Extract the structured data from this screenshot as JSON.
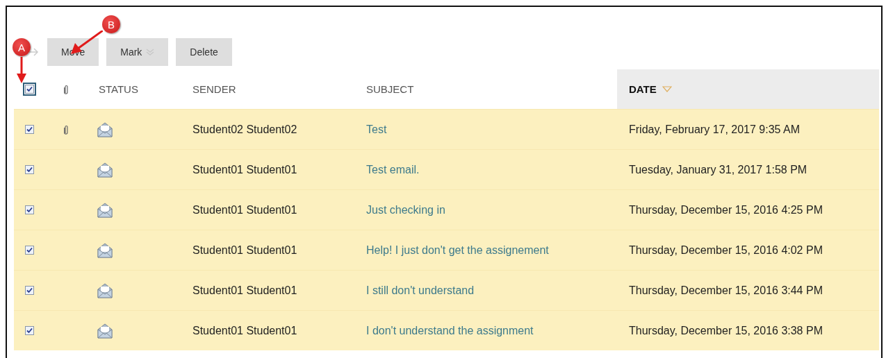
{
  "callouts": [
    {
      "label": "A",
      "kind": "down"
    },
    {
      "label": "B",
      "kind": "diagonal"
    }
  ],
  "toolbar": {
    "buttons": [
      {
        "label": "Move",
        "kind": "plain"
      },
      {
        "label": "Mark",
        "kind": "menu"
      },
      {
        "label": "Delete",
        "kind": "plain"
      }
    ]
  },
  "table": {
    "select_all": {
      "checked": true
    },
    "columns": [
      {
        "label": "STATUS",
        "sorted": false
      },
      {
        "label": "SENDER",
        "sorted": false
      },
      {
        "label": "SUBJECT",
        "sorted": false
      },
      {
        "label": "DATE",
        "sorted": true
      }
    ],
    "rows": [
      {
        "checked": true,
        "attachment": true,
        "sender": "Student02 Student02",
        "subject": "Test",
        "date": "Friday, February 17, 2017 9:35 AM"
      },
      {
        "checked": true,
        "attachment": false,
        "sender": "Student01 Student01",
        "subject": "Test email.",
        "date": "Tuesday, January 31, 2017 1:58 PM"
      },
      {
        "checked": true,
        "attachment": false,
        "sender": "Student01 Student01",
        "subject": "Just checking in",
        "date": "Thursday, December 15, 2016 4:25 PM"
      },
      {
        "checked": true,
        "attachment": false,
        "sender": "Student01 Student01",
        "subject": "Help! I just don't get the assignement",
        "date": "Thursday, December 15, 2016 4:02 PM"
      },
      {
        "checked": true,
        "attachment": false,
        "sender": "Student01 Student01",
        "subject": "I still don't understand",
        "date": "Thursday, December 15, 2016 3:44 PM"
      },
      {
        "checked": true,
        "attachment": false,
        "sender": "Student01 Student01",
        "subject": "I don't understand the assignment",
        "date": "Thursday, December 15, 2016 3:38 PM"
      }
    ]
  }
}
